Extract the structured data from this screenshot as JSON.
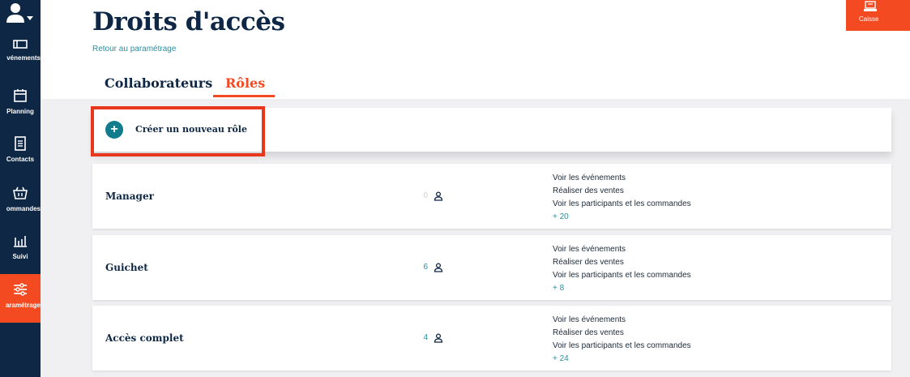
{
  "page": {
    "title": "Droits d'accès",
    "back_link": "Retour au paramétrage",
    "tabs": [
      {
        "label": "Collaborateurs",
        "active": false
      },
      {
        "label": "Rôles",
        "active": true
      }
    ],
    "create_role_label": "Créer un nouveau rôle",
    "caisse_label": "Caisse"
  },
  "sidebar": {
    "items": [
      {
        "label": "vénements",
        "icon": "ticket-icon"
      },
      {
        "label": "Planning",
        "icon": "calendar-icon"
      },
      {
        "label": "Contacts",
        "icon": "contacts-icon"
      },
      {
        "label": "ommandes",
        "icon": "basket-icon"
      },
      {
        "label": "Suivi",
        "icon": "chart-icon"
      },
      {
        "label": "aramétrage",
        "icon": "sliders-icon",
        "active": true
      }
    ]
  },
  "roles": [
    {
      "name": "Manager",
      "count": "0",
      "permissions": [
        "Voir les événements",
        "Réaliser des ventes",
        "Voir les participants et les commandes"
      ],
      "more": "+ 20"
    },
    {
      "name": "Guichet",
      "count": "6",
      "permissions": [
        "Voir les événements",
        "Réaliser des ventes",
        "Voir les participants et les commandes"
      ],
      "more": "+ 8"
    },
    {
      "name": "Accès complet",
      "count": "4",
      "permissions": [
        "Voir les événements",
        "Réaliser des ventes",
        "Voir les participants et les commandes"
      ],
      "more": "+ 24"
    }
  ],
  "colors": {
    "accent": "#f34a22",
    "navy": "#0d2745",
    "teal": "#117d8c"
  }
}
